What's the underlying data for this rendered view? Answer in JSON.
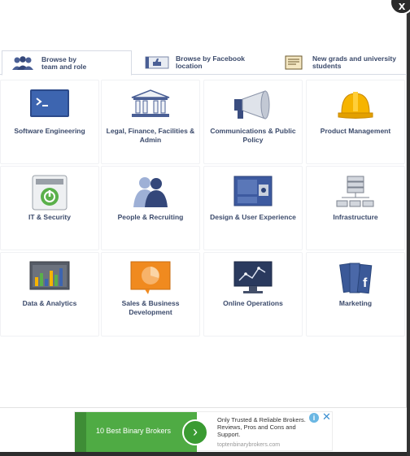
{
  "close_label": "x",
  "tabs": [
    {
      "line1": "Browse by",
      "line2": "team and role",
      "icon": "people-icon"
    },
    {
      "line1": "Browse by Facebook",
      "line2": "location",
      "icon": "thumbs-up-sign-icon"
    },
    {
      "line1": "New grads and university",
      "line2": "students",
      "icon": "certificate-icon"
    }
  ],
  "categories": [
    {
      "label": "Software Engineering",
      "icon": "terminal-icon"
    },
    {
      "label": "Legal, Finance, Facilities & Admin",
      "icon": "building-icon"
    },
    {
      "label": "Communications & Public Policy",
      "icon": "megaphone-icon"
    },
    {
      "label": "Product Management",
      "icon": "hard-hat-icon"
    },
    {
      "label": "IT & Security",
      "icon": "power-server-icon"
    },
    {
      "label": "People & Recruiting",
      "icon": "people-silhouette-icon"
    },
    {
      "label": "Design & User Experience",
      "icon": "design-board-icon"
    },
    {
      "label": "Infrastructure",
      "icon": "server-network-icon"
    },
    {
      "label": "Data & Analytics",
      "icon": "bar-chart-icon"
    },
    {
      "label": "Sales & Business Development",
      "icon": "pie-chart-icon"
    },
    {
      "label": "Online Operations",
      "icon": "monitor-graph-icon"
    },
    {
      "label": "Marketing",
      "icon": "facebook-books-icon"
    }
  ],
  "ad": {
    "title": "10 Best Binary Brokers",
    "arrow": "›",
    "text": "Only Trusted & Reliable Brokers. Reviews, Pros and Cons and Support.",
    "domain": "toptenbinarybrokers.com",
    "info": "i",
    "close": "✕"
  },
  "colors": {
    "label_text": "#3b4a6b",
    "ad_green": "#4fab44",
    "icon_blue": "#4a5f95"
  }
}
